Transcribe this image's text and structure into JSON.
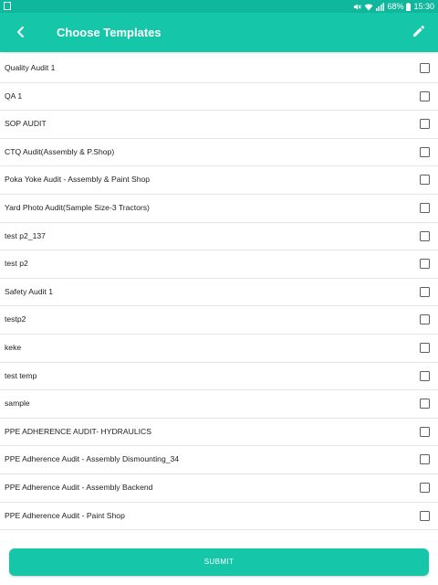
{
  "status_bar": {
    "battery": "68%",
    "time": "15:30"
  },
  "app_bar": {
    "title": "Choose Templates",
    "back_icon": "chevron-left-icon",
    "edit_icon": "pencil-icon"
  },
  "templates": [
    {
      "name": "Quality Audit 1",
      "checked": false
    },
    {
      "name": "QA 1",
      "checked": false
    },
    {
      "name": "SOP AUDIT",
      "checked": false
    },
    {
      "name": "CTQ Audit(Assembly & P.Shop)",
      "checked": false
    },
    {
      "name": "Poka Yoke Audit - Assembly & Paint Shop",
      "checked": false
    },
    {
      "name": "Yard Photo Audit(Sample Size-3 Tractors)",
      "checked": false
    },
    {
      "name": "test p2_137",
      "checked": false
    },
    {
      "name": "test p2",
      "checked": false
    },
    {
      "name": "Safety Audit 1",
      "checked": false
    },
    {
      "name": "testp2",
      "checked": false
    },
    {
      "name": "keke",
      "checked": false
    },
    {
      "name": "test temp",
      "checked": false
    },
    {
      "name": "sample",
      "checked": false
    },
    {
      "name": "PPE ADHERENCE AUDIT- HYDRAULICS",
      "checked": false
    },
    {
      "name": "PPE Adherence Audit - Assembly Dismounting_34",
      "checked": false
    },
    {
      "name": "PPE Adherence Audit - Assembly Backend",
      "checked": false
    },
    {
      "name": "PPE Adherence Audit - Paint Shop",
      "checked": false
    }
  ],
  "submit_label": "SUBMIT",
  "colors": {
    "accent": "#16c6a9",
    "status_bar": "#0fb89c"
  }
}
